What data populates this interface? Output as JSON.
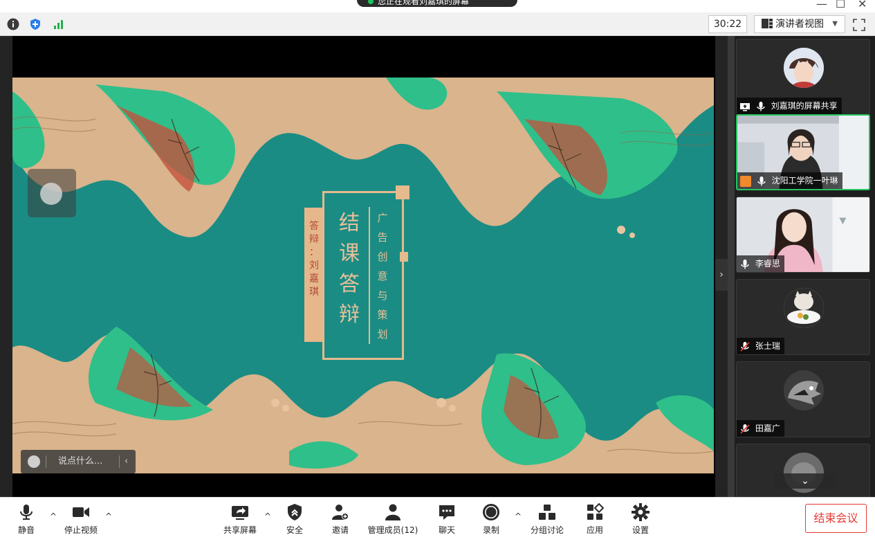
{
  "titlebar": {
    "share_notice": "您正在观看刘嘉琪的屏幕"
  },
  "infobar": {
    "timer": "30:22",
    "view_label": "演讲者视图"
  },
  "slide": {
    "main_title_chars": [
      "结",
      "课",
      "答",
      "辩"
    ],
    "subtitle_chars": [
      "广",
      "告",
      "创",
      "意",
      "与",
      "策",
      "划"
    ],
    "name_tab_chars": [
      "答",
      "辩",
      "：",
      "刘",
      "嘉",
      "琪"
    ],
    "colors": {
      "teal": "#1a8c84",
      "sand": "#e5ba8d",
      "red": "#c4523d",
      "green": "#2fbf8a"
    }
  },
  "chat": {
    "placeholder": "说点什么..."
  },
  "participants": [
    {
      "name": "刘嘉琪的屏幕共享",
      "icons": [
        "share-screen-icon",
        "mic-icon"
      ],
      "kind": "avatar"
    },
    {
      "name": "沈阳工学院一叶琳",
      "icons": [
        "host-icon",
        "mic-icon"
      ],
      "kind": "video",
      "active": true
    },
    {
      "name": "李睿思",
      "icons": [
        "mic-icon"
      ],
      "kind": "video"
    },
    {
      "name": "张士瑞",
      "icons": [
        "mic-muted-icon"
      ],
      "kind": "avatar"
    },
    {
      "name": "田嘉广",
      "icons": [
        "mic-muted-icon"
      ],
      "kind": "avatar"
    }
  ],
  "toolbar": {
    "mute": "静音",
    "stop_video": "停止视频",
    "share_screen": "共享屏幕",
    "security": "安全",
    "invite": "邀请",
    "manage_members": "管理成员(12)",
    "chat": "聊天",
    "record": "录制",
    "breakout": "分组讨论",
    "apps": "应用",
    "settings": "设置",
    "end_meeting": "结束会议"
  }
}
